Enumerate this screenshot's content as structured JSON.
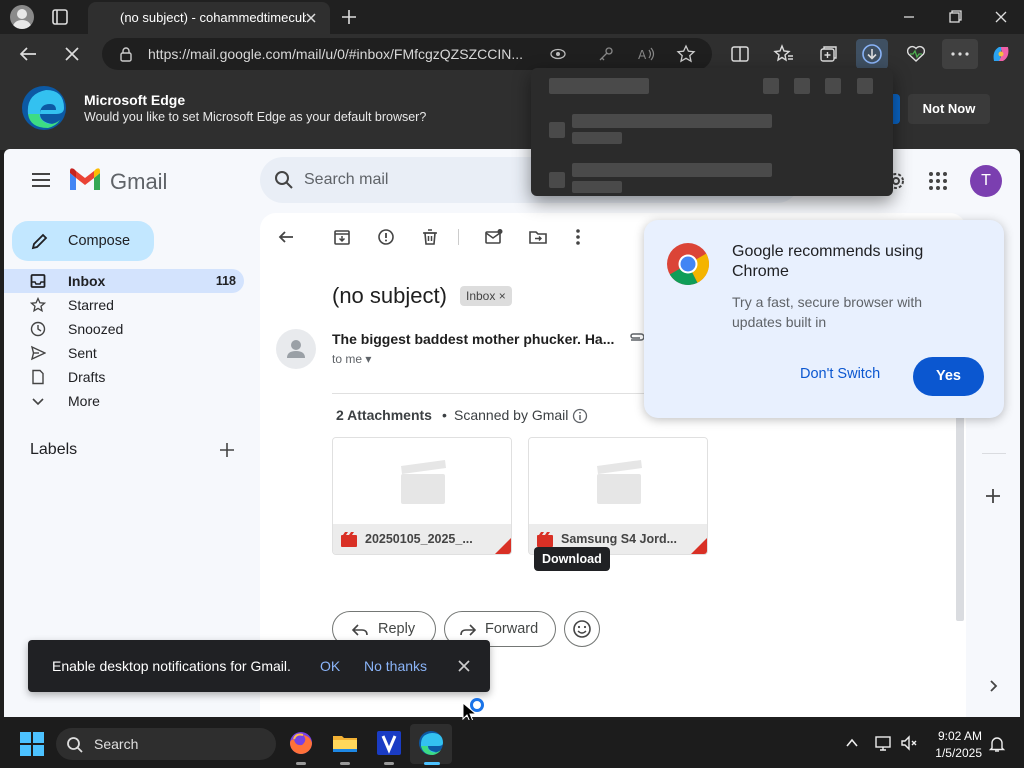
{
  "browser": {
    "tab_title": "(no subject) - cohammedtimecub",
    "url": "https://mail.google.com/mail/u/0/#inbox/FMfcgzQZSZCCIN..."
  },
  "default_bar": {
    "title": "Microsoft Edge",
    "message": "Would you like to set Microsoft Edge as your default browser?",
    "not_now": "Not Now"
  },
  "gmail": {
    "wordmark": "Gmail",
    "search_placeholder": "Search mail",
    "avatar_initial": "T",
    "compose": "Compose",
    "nav": [
      {
        "label": "Inbox",
        "count": "118"
      },
      {
        "label": "Starred"
      },
      {
        "label": "Snoozed"
      },
      {
        "label": "Sent"
      },
      {
        "label": "Drafts"
      },
      {
        "label": "More"
      }
    ],
    "labels_title": "Labels"
  },
  "message": {
    "subject": "(no subject)",
    "inbox_chip": "Inbox ×",
    "sender": "The biggest baddest mother phucker. Ha...",
    "to": "to me ▾",
    "attachments_count": "2 Attachments",
    "dot": "•",
    "scanned": "Scanned by Gmail",
    "attachments": [
      {
        "name": "20250105_2025_..."
      },
      {
        "name": "Samsung S4 Jord..."
      }
    ],
    "download_tooltip": "Download",
    "reply": "Reply",
    "forward": "Forward"
  },
  "chrome_promo": {
    "title": "Google recommends using Chrome",
    "body": "Try a fast, secure browser with updates built in",
    "dont_switch": "Don't Switch",
    "yes": "Yes"
  },
  "notification_toast": {
    "text": "Enable desktop notifications for Gmail.",
    "ok": "OK",
    "no_thanks": "No thanks"
  },
  "taskbar": {
    "search": "Search",
    "time": "9:02 AM",
    "date": "1/5/2025"
  },
  "colors": {
    "edge_accent": "#0a64c4",
    "gmail_compose": "#c2e7ff",
    "gmail_active_nav": "#d3e3fd",
    "google_blue": "#0b57d0"
  }
}
